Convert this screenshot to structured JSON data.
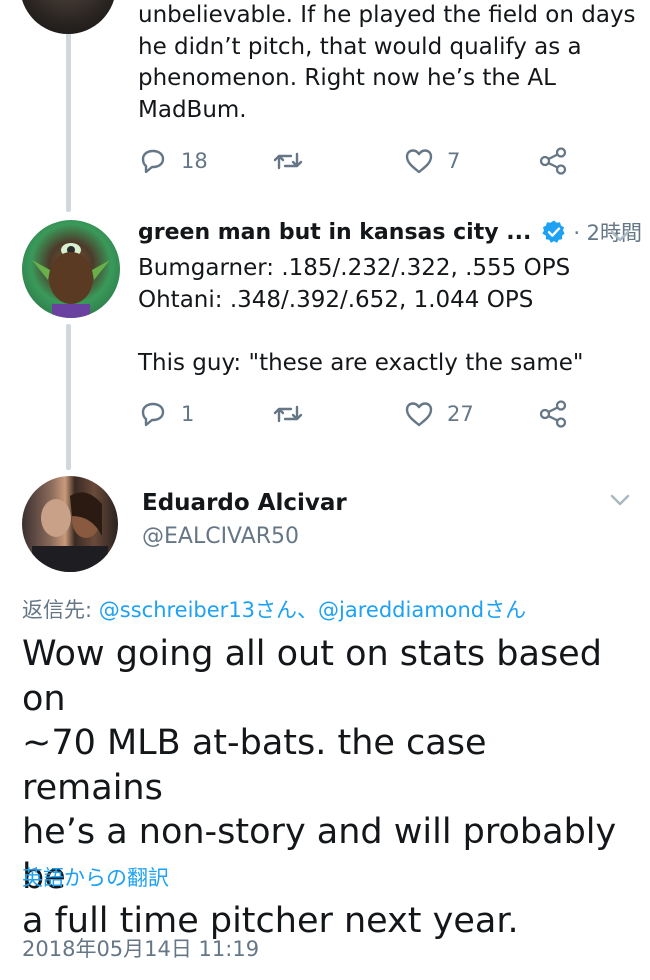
{
  "previous_tweet": {
    "text": "unbelievable.  If he played the field on days\nhe didn’t pitch, that would qualify as a\nphenomenon. Right now he’s the AL\nMadBum.",
    "reply_count": "18",
    "retweet_count": "",
    "like_count": "7"
  },
  "middle_tweet": {
    "display_name": "green man but in kansas city ...",
    "time_ago": "· 2時間",
    "text": "Bumgarner: .185/.232/.322, .555 OPS\nOhtani: .348/.392/.652, 1.044 OPS\n\nThis guy: \"these are exactly the same\"",
    "reply_count": "1",
    "retweet_count": "",
    "like_count": "27"
  },
  "main_tweet": {
    "display_name": "Eduardo Alcivar",
    "handle": "@EALCIVAR50",
    "reply_prefix": "返信先: ",
    "reply_mentions": "@sschreiber13さん、@jareddiamondさん",
    "text": "Wow going all out on stats based on\n~70 MLB at-bats. the case remains\nhe’s a non-story and will probably be\na full time pitcher next year.",
    "translate_label": "英語からの翻訳",
    "timestamp": "2018年05月14日 11:19"
  },
  "icons": [
    "reply-icon",
    "retweet-icon",
    "like-icon",
    "share-icon",
    "verified-badge-icon",
    "chevron-down-icon"
  ],
  "colors": {
    "link": "#1da1f2",
    "secondary": "#657786",
    "thread_line": "#d0d8de"
  }
}
